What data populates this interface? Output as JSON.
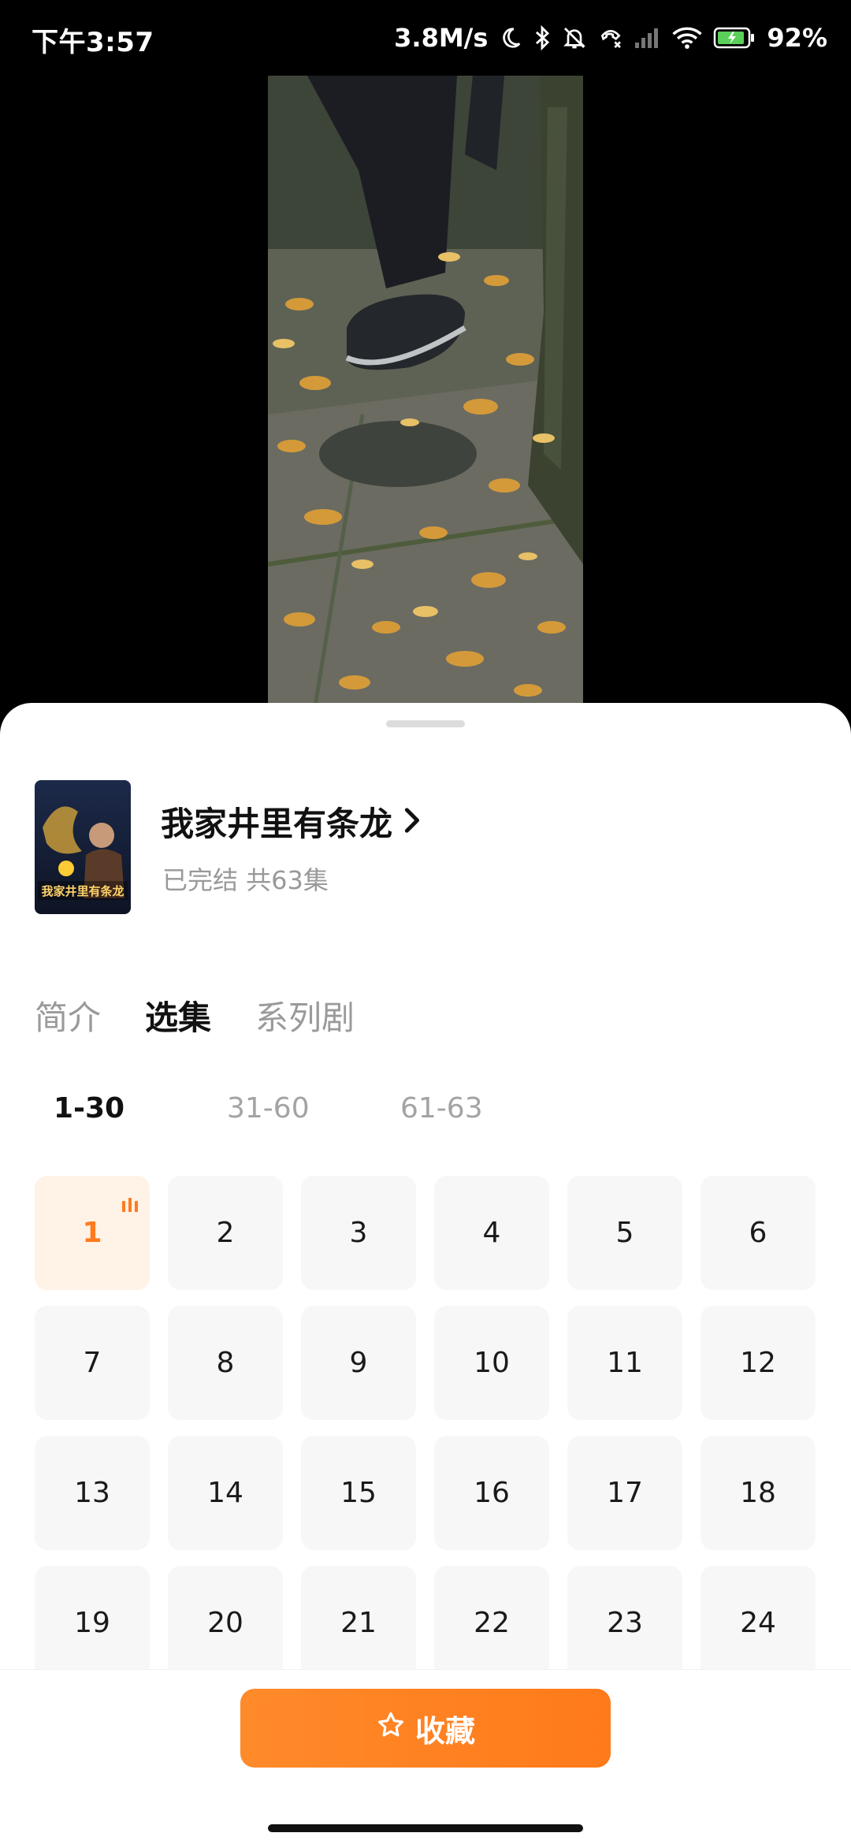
{
  "status_bar": {
    "time": "下午3:57",
    "net_speed": "3.8M/s",
    "battery": "92%"
  },
  "drama": {
    "title": "我家井里有条龙",
    "meta": "已完结 共63集",
    "cover_title": "我家井里有条龙"
  },
  "tabs": [
    {
      "label": "简介",
      "active": false
    },
    {
      "label": "选集",
      "active": true
    },
    {
      "label": "系列剧",
      "active": false
    }
  ],
  "ranges": [
    {
      "label": "1-30",
      "active": true
    },
    {
      "label": "31-60",
      "active": false
    },
    {
      "label": "61-63",
      "active": false
    }
  ],
  "episodes": [
    "1",
    "2",
    "3",
    "4",
    "5",
    "6",
    "7",
    "8",
    "9",
    "10",
    "11",
    "12",
    "13",
    "14",
    "15",
    "16",
    "17",
    "18",
    "19",
    "20",
    "21",
    "22",
    "23",
    "24"
  ],
  "current_episode": "1",
  "favorite_label": "收藏",
  "colors": {
    "accent": "#ff7a1f",
    "active_tile_bg": "#fff2e6",
    "tile_bg": "#f7f7f7"
  }
}
